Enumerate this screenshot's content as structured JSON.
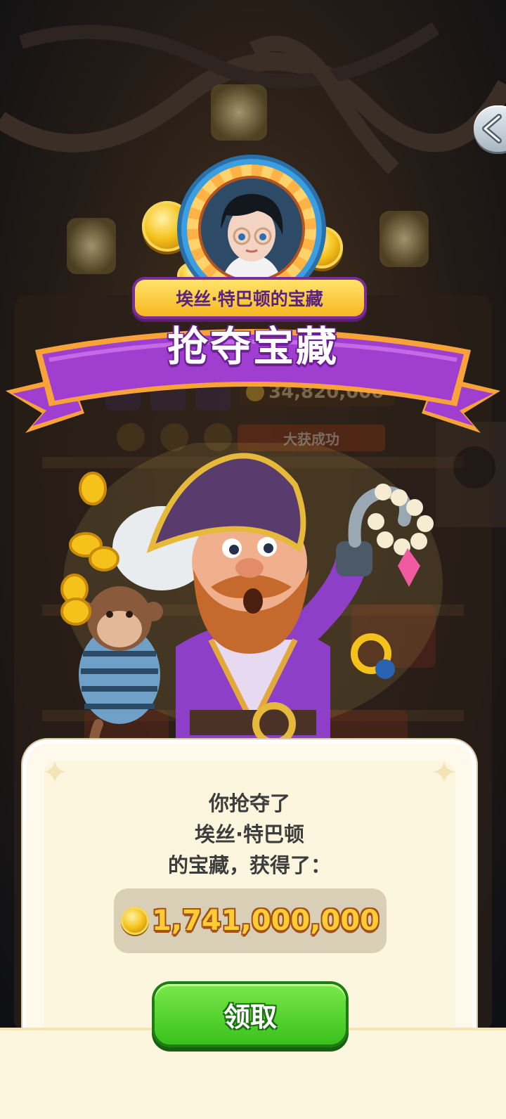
{
  "banner": {
    "subtitle": "埃丝·特巴顿的宝藏",
    "title": "抢夺宝藏"
  },
  "background": {
    "treasure_amount": "34,820,000",
    "status_label": "大获成功"
  },
  "result": {
    "line1": "你抢夺了",
    "line2": "埃丝·特巴顿",
    "line3": "的宝藏，获得了：",
    "reward_amount": "1,741,000,000"
  },
  "actions": {
    "claim_label": "领取"
  },
  "colors": {
    "ribbon_purple": "#a03ed0",
    "ribbon_edge": "#f7a33a",
    "coin_gold": "#f5c21c",
    "claim_green": "#39c21c",
    "panel_cream": "#fdf6df"
  },
  "icons": {
    "back": "chevron-left-icon",
    "coin": "gold-coin-icon",
    "avatar": "player-avatar"
  }
}
